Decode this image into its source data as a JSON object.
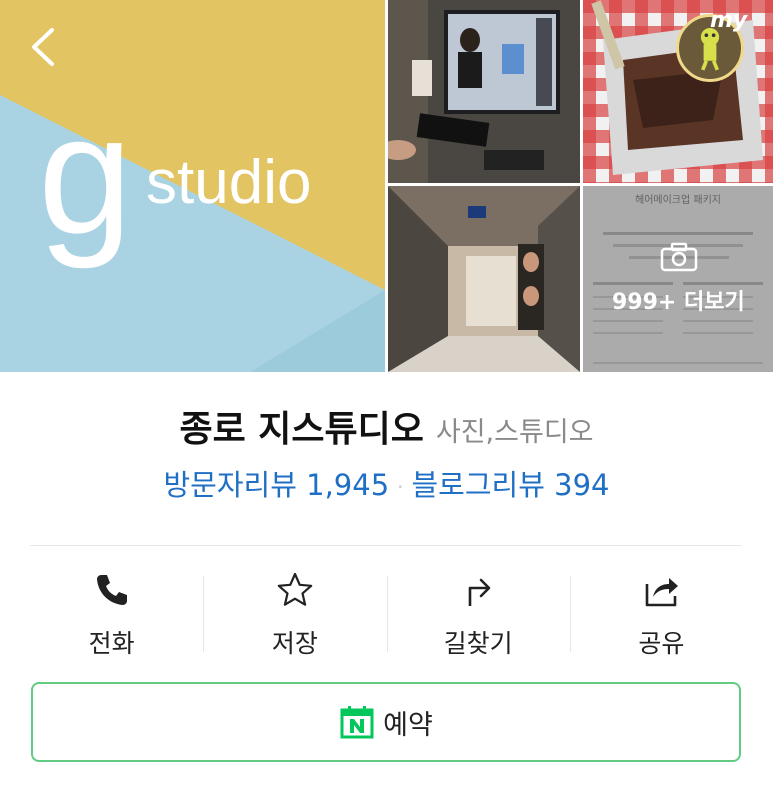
{
  "gallery": {
    "logo_letter": "g",
    "logo_word": "studio",
    "my_badge": "my",
    "more_label": "999+ 더보기",
    "thumb4_title": "헤어메이크업 패키지",
    "colors": {
      "sky": "#a9d3e2",
      "yellow": "#e3c462"
    }
  },
  "place": {
    "name": "종로 지스튜디오",
    "category": "사진,스튜디오",
    "visitor_reviews": "방문자리뷰 1,945",
    "blog_reviews": "블로그리뷰 394",
    "separator": "·"
  },
  "actions": [
    {
      "label": "전화",
      "icon": "phone-icon"
    },
    {
      "label": "저장",
      "icon": "star-icon"
    },
    {
      "label": "길찾기",
      "icon": "directions-icon"
    },
    {
      "label": "공유",
      "icon": "share-icon"
    }
  ],
  "reserve": {
    "label": "예약",
    "icon": "naver-booking-icon",
    "accent": "#61cc82"
  }
}
